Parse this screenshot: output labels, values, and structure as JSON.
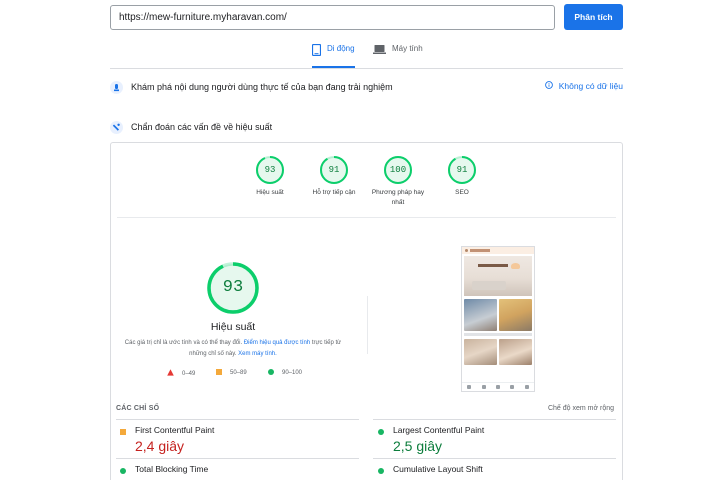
{
  "search": {
    "url_value": "https://mew-furniture.myharavan.com/",
    "analyze_label": "Phân tích"
  },
  "tabs": [
    {
      "label": "Di động",
      "icon": "mobile-icon",
      "active": true
    },
    {
      "label": "Máy tính",
      "icon": "laptop-icon",
      "active": false
    }
  ],
  "field_data": {
    "title": "Khám phá nội dung người dùng thực tế của bạn đang trải nghiệm",
    "no_data_label": "Không có dữ liệu"
  },
  "diagnose": {
    "title": "Chẩn đoán các vấn đề về hiệu suất"
  },
  "scores": [
    {
      "label": "Hiệu suất",
      "score": 93
    },
    {
      "label": "Hỗ trợ tiếp cận",
      "score": 91
    },
    {
      "label": "Phương pháp hay nhất",
      "score": 100
    },
    {
      "label": "SEO",
      "score": 91
    }
  ],
  "performance": {
    "score": 93,
    "title": "Hiệu suất",
    "desc_pre": "Các giá trị chỉ là ước tính và có thể thay đổi.",
    "desc_link": "Điểm hiệu quả được tính",
    "desc_mid": "trực tiếp từ những chỉ số này.",
    "calc_link": "Xem máy tính."
  },
  "legend": [
    {
      "range": "0–49",
      "shape": "triangle",
      "color": "#e53935"
    },
    {
      "range": "50–89",
      "shape": "square",
      "color": "#f4a93b"
    },
    {
      "range": "90–100",
      "shape": "circle",
      "color": "#18b663"
    }
  ],
  "metrics": {
    "heading": "CÁC CHỈ SỐ",
    "expand_label": "Chế độ xem mở rộng",
    "items": [
      {
        "name": "First Contentful Paint",
        "value": "2,4 giây",
        "rating": "average",
        "color": "#c5221f"
      },
      {
        "name": "Largest Contentful Paint",
        "value": "2,5 giây",
        "rating": "good",
        "color": "#0c7d3c"
      },
      {
        "name": "Total Blocking Time",
        "value": "",
        "rating": "good",
        "color": "#0c7d3c"
      },
      {
        "name": "Cumulative Layout Shift",
        "value": "",
        "rating": "good",
        "color": "#0c7d3c"
      }
    ]
  },
  "colors": {
    "accent": "#1a73e8",
    "good": "#0cce6b",
    "good_text": "#0c7d3c",
    "average": "#ffa400",
    "poor": "#ff4e42"
  }
}
